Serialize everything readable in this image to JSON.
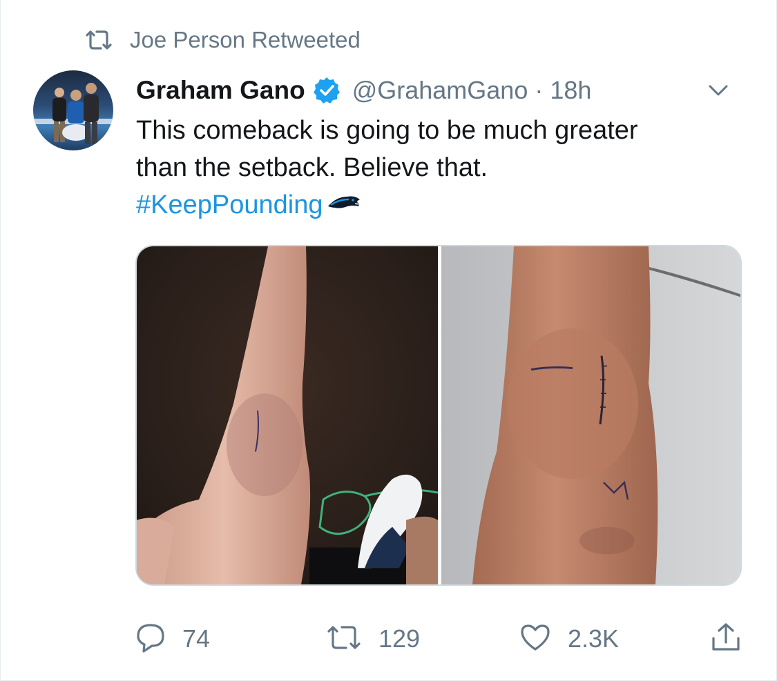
{
  "retweet_context": {
    "icon": "retweet-icon",
    "label": "Joe Person Retweeted"
  },
  "tweet": {
    "author_name": "Graham Gano",
    "verified_icon": "verified-badge-icon",
    "handle": "@GrahamGano",
    "separator": "·",
    "time": "18h",
    "menu_icon": "chevron-down-icon",
    "text_line1": "This comeback is going to be much greater",
    "text_line2": "than the setback. Believe that.",
    "hashtag": "#KeepPounding",
    "hashflag_icon": "panthers-hashflag-icon",
    "media": [
      {
        "name": "photo-leg-stitches"
      },
      {
        "name": "photo-knee-closeup"
      }
    ]
  },
  "actions": {
    "reply": {
      "icon": "reply-icon",
      "count": "74"
    },
    "retweet": {
      "icon": "retweet-icon",
      "count": "129"
    },
    "like": {
      "icon": "heart-icon",
      "count": "2.3K"
    },
    "share": {
      "icon": "share-icon"
    }
  },
  "colors": {
    "link": "#1b95e0",
    "secondary_text": "#657786",
    "verified": "#1da1f2"
  }
}
